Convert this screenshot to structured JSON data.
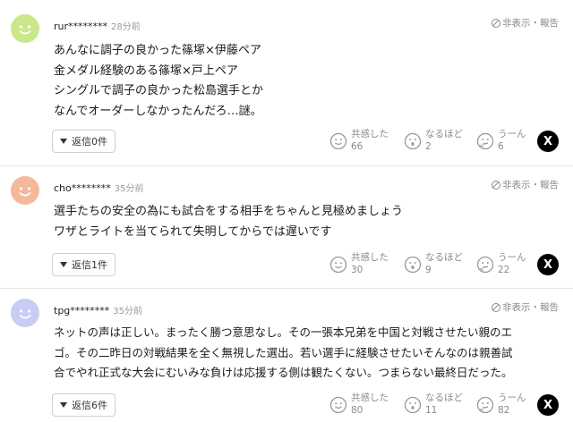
{
  "labels": {
    "report": "非表示・報告",
    "reaction_empathy": "共感した",
    "reaction_insight": "なるほど",
    "reaction_hmm": "うーん",
    "x_icon": "X"
  },
  "comments": [
    {
      "username": "rur********",
      "time": "28分前",
      "avatar_color": "#c9e88a",
      "lines": [
        "あんなに調子の良かった篠塚×伊藤ペア",
        "金メダル経験のある篠塚×戸上ペア",
        "シングルで調子の良かった松島選手とか",
        "なんでオーダーしなかったんだろ…謎。"
      ],
      "reply_label": "返信0件",
      "empathy": "66",
      "insight": "2",
      "hmm": "6"
    },
    {
      "username": "cho********",
      "time": "35分前",
      "avatar_color": "#f4b99a",
      "lines": [
        "選手たちの安全の為にも試合をする相手をちゃんと見極めましょう",
        "ワザとライトを当てられて失明してからでは遅いです"
      ],
      "reply_label": "返信1件",
      "empathy": "30",
      "insight": "9",
      "hmm": "22"
    },
    {
      "username": "tpg********",
      "time": "35分前",
      "avatar_color": "#c9cdf5",
      "lines": [
        "ネットの声は正しい。まったく勝つ意思なし。その一張本兄弟を中国と対戦させたい親のエ",
        "ゴ。その二昨日の対戦結果を全く無視した選出。若い選手に経験させたいそんなのは親善試",
        "合でやれ正式な大会にむいみな負けは応援する側は観たくない。つまらない最終日だった。"
      ],
      "reply_label": "返信6件",
      "empathy": "80",
      "insight": "11",
      "hmm": "82"
    }
  ]
}
